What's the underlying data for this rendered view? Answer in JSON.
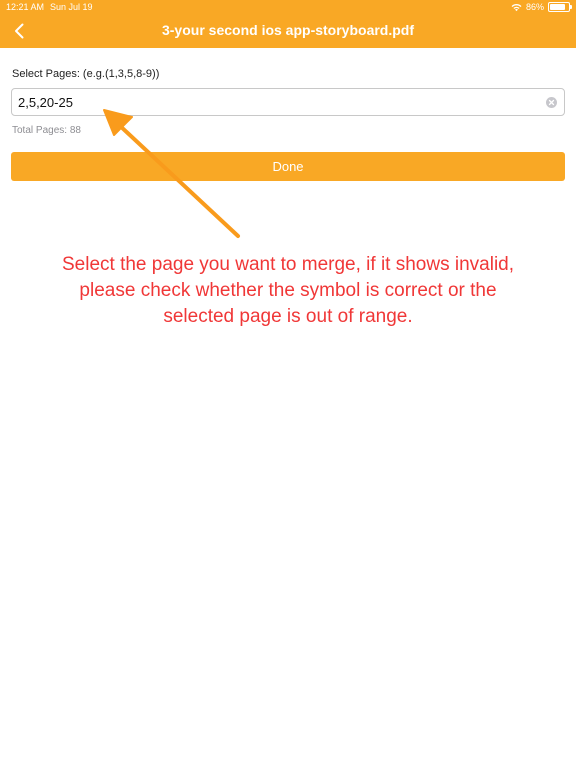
{
  "status_bar": {
    "time": "12:21 AM",
    "date": "Sun Jul 19",
    "battery_percent": "86%",
    "battery_level": 0.86,
    "icons": [
      "wifi-icon",
      "battery-icon"
    ]
  },
  "nav": {
    "back_icon": "chevron-left-icon",
    "title": "3-your second ios app-storyboard.pdf"
  },
  "form": {
    "label": "Select Pages: (e.g.(1,3,5,8-9))",
    "input_value": "2,5,20-25",
    "clear_icon": "clear-circle-icon",
    "total_pages": "Total Pages: 88",
    "done_label": "Done"
  },
  "annotation": {
    "lines": [
      "Select the page you want to merge, if it shows invalid,",
      "please check whether the symbol is correct or the",
      "selected page is out of range."
    ]
  },
  "colors": {
    "accent": "#F9A825",
    "annotation_text": "#F03737",
    "annotation_arrow": "#F99B1C"
  }
}
